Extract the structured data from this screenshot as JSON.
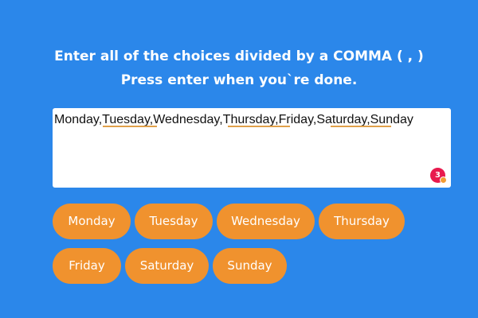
{
  "instructions": {
    "line1": "Enter all of the choices divided by a COMMA ( , )",
    "line2": "Press enter when you`re done."
  },
  "input": {
    "value": "Monday,Tuesday,Wednesday,Thursday,Friday,Saturday,Sunday"
  },
  "grammar_badge": {
    "count": "3"
  },
  "choices": [
    "Monday",
    "Tuesday",
    "Wednesday",
    "Thursday",
    "Friday",
    "Saturday",
    "Sunday"
  ],
  "colors": {
    "background": "#2b87ea",
    "chip": "#f0922e",
    "badge": "#e8194d",
    "underline": "#e0a04a"
  }
}
